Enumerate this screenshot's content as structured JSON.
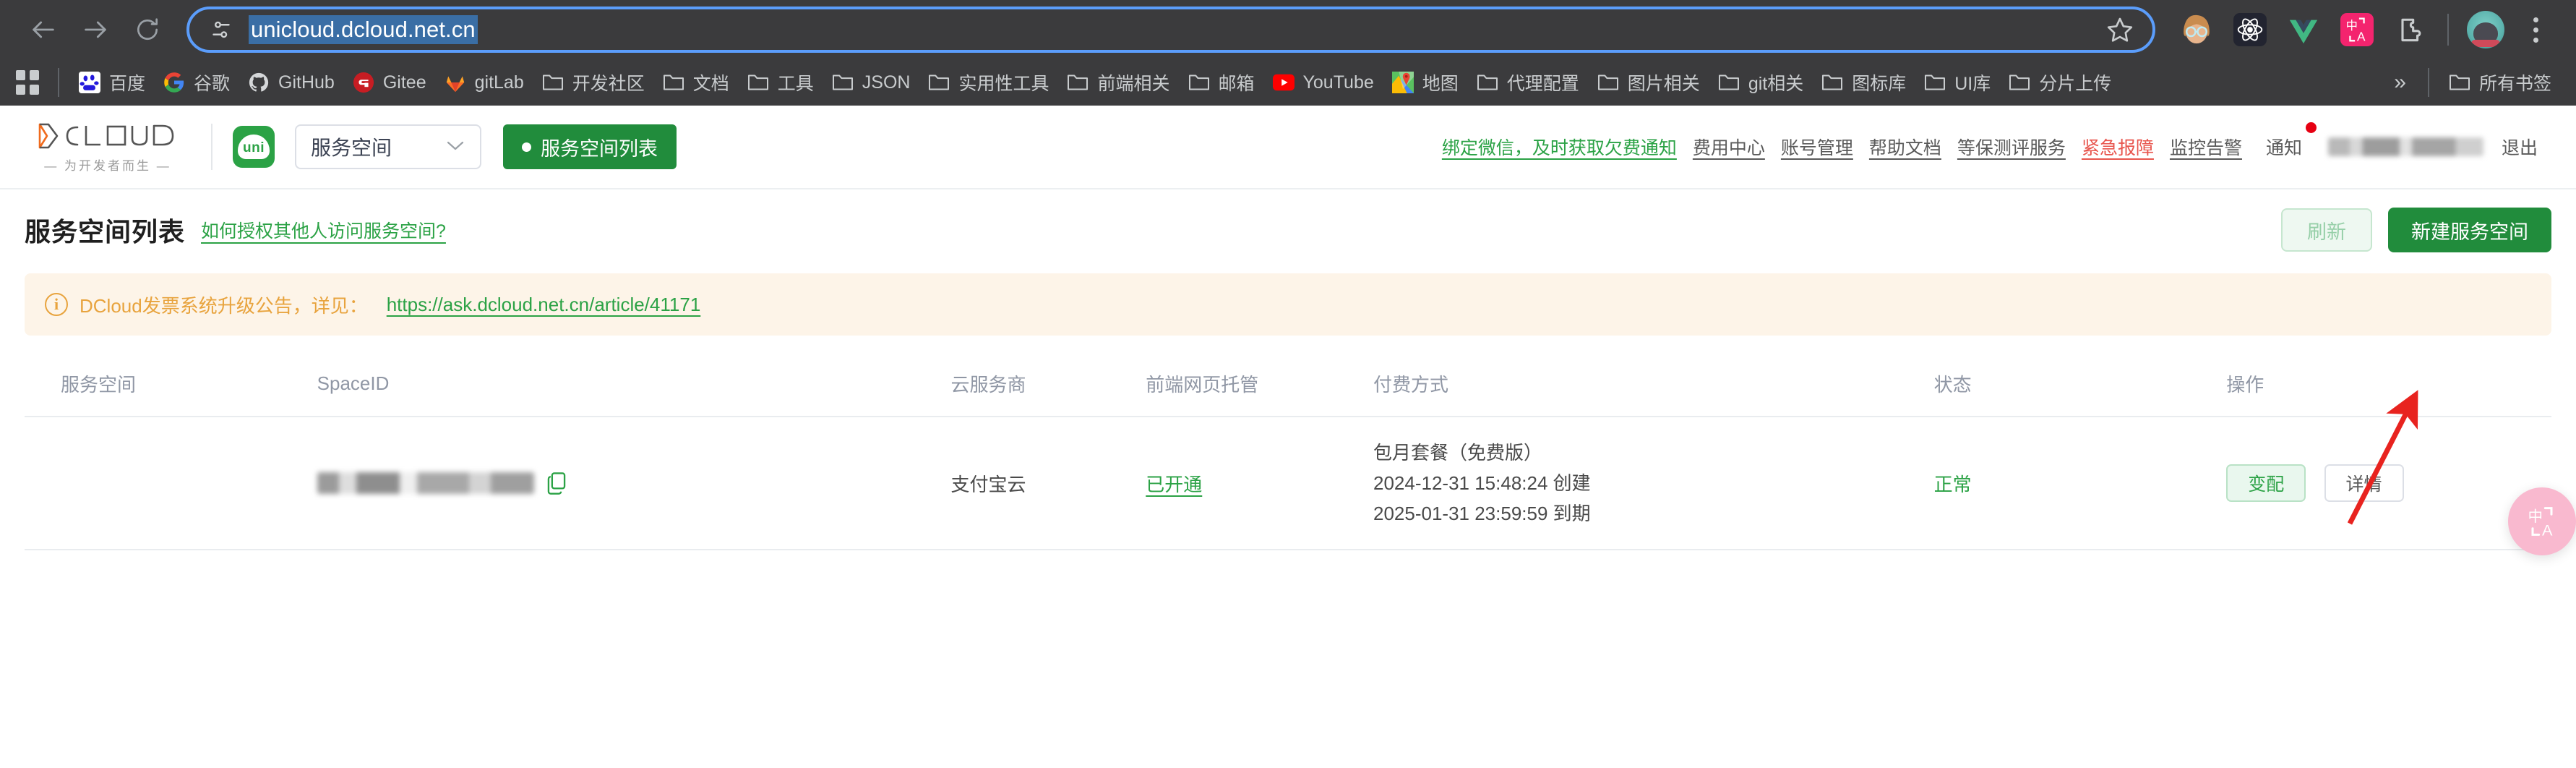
{
  "browser": {
    "nav": {
      "back": "back-arrow",
      "forward": "forward-arrow",
      "reload": "reload-icon"
    },
    "omnibox": {
      "site_icon": "page-settings-icon",
      "url": "unicloud.dcloud.net.cn",
      "bookmark_icon": "star-icon"
    },
    "extensions": [
      {
        "name": "face-avatar-extension-icon"
      },
      {
        "name": "react-devtools-icon"
      },
      {
        "name": "vue-devtools-icon"
      },
      {
        "name": "translate-extension-icon",
        "label": "中A"
      },
      {
        "name": "puzzle-extensions-icon"
      }
    ],
    "profile": "profile-avatar",
    "menu": "three-dot-menu-icon",
    "bookmarks": [
      {
        "label": "百度",
        "icon": "baidu-icon"
      },
      {
        "label": "谷歌",
        "icon": "google-icon"
      },
      {
        "label": "GitHub",
        "icon": "github-icon"
      },
      {
        "label": "Gitee",
        "icon": "gitee-icon"
      },
      {
        "label": "gitLab",
        "icon": "gitlab-icon"
      },
      {
        "label": "开发社区",
        "icon": "folder-icon"
      },
      {
        "label": "文档",
        "icon": "folder-icon"
      },
      {
        "label": "工具",
        "icon": "folder-icon"
      },
      {
        "label": "JSON",
        "icon": "folder-icon"
      },
      {
        "label": "实用性工具",
        "icon": "folder-icon"
      },
      {
        "label": "前端相关",
        "icon": "folder-icon"
      },
      {
        "label": "邮箱",
        "icon": "folder-icon"
      },
      {
        "label": "YouTube",
        "icon": "youtube-icon"
      },
      {
        "label": "地图",
        "icon": "google-maps-icon"
      },
      {
        "label": "代理配置",
        "icon": "folder-icon"
      },
      {
        "label": "图片相关",
        "icon": "folder-icon"
      },
      {
        "label": "git相关",
        "icon": "folder-icon"
      },
      {
        "label": "图标库",
        "icon": "folder-icon"
      },
      {
        "label": "UI库",
        "icon": "folder-icon"
      },
      {
        "label": "分片上传",
        "icon": "folder-icon"
      }
    ],
    "overflow": "»",
    "all_bookmarks": "所有书签"
  },
  "site_header": {
    "logo_text": "DCLOUD",
    "logo_tagline": "— 为开发者而生 —",
    "uni_logo": "uni",
    "space_select_value": "服务空间",
    "space_list_button": "服务空间列表",
    "links": [
      {
        "label": "绑定微信，及时获取欠费通知",
        "style": "green"
      },
      {
        "label": "费用中心",
        "style": "default"
      },
      {
        "label": "账号管理",
        "style": "default"
      },
      {
        "label": "帮助文档",
        "style": "default"
      },
      {
        "label": "等保测评服务",
        "style": "default"
      },
      {
        "label": "紧急报障",
        "style": "red"
      },
      {
        "label": "监控告警",
        "style": "default"
      }
    ],
    "notify_label": "通知",
    "logout_label": "退出"
  },
  "main": {
    "title": "服务空间列表",
    "title_link": "如何授权其他人访问服务空间?",
    "refresh_button": "刷新",
    "new_space_button": "新建服务空间",
    "notice": {
      "icon": "info-circle-icon",
      "text": "DCloud发票系统升级公告，详见：",
      "link": "https://ask.dcloud.net.cn/article/41171"
    },
    "table": {
      "headers": [
        "服务空间",
        "SpaceID",
        "云服务商",
        "前端网页托管",
        "付费方式",
        "状态",
        "操作"
      ],
      "rows": [
        {
          "space_name": "",
          "space_id": "",
          "copy_icon": "copy-icon",
          "provider": "支付宝云",
          "hosting": "已开通",
          "pay_plan": "包月套餐（免费版）",
          "pay_created": "2024-12-31 15:48:24 创建",
          "pay_expire": "2025-01-31 23:59:59 到期",
          "status": "正常",
          "action_change": "变配",
          "action_detail": "详情"
        }
      ]
    }
  },
  "annotations": {
    "arrow": "red-arrow-pointing-to-new-space-button"
  },
  "floating": {
    "translate_widget": "中A"
  },
  "colors": {
    "brand_green": "#2ba245",
    "button_green": "#218c3c",
    "notice_orange": "#e8a33d",
    "alert_red": "#e8554d",
    "annotation_red": "#e8231f",
    "chrome_dark": "#3b3b3d",
    "omnibox_blue": "#5b9dfb"
  }
}
